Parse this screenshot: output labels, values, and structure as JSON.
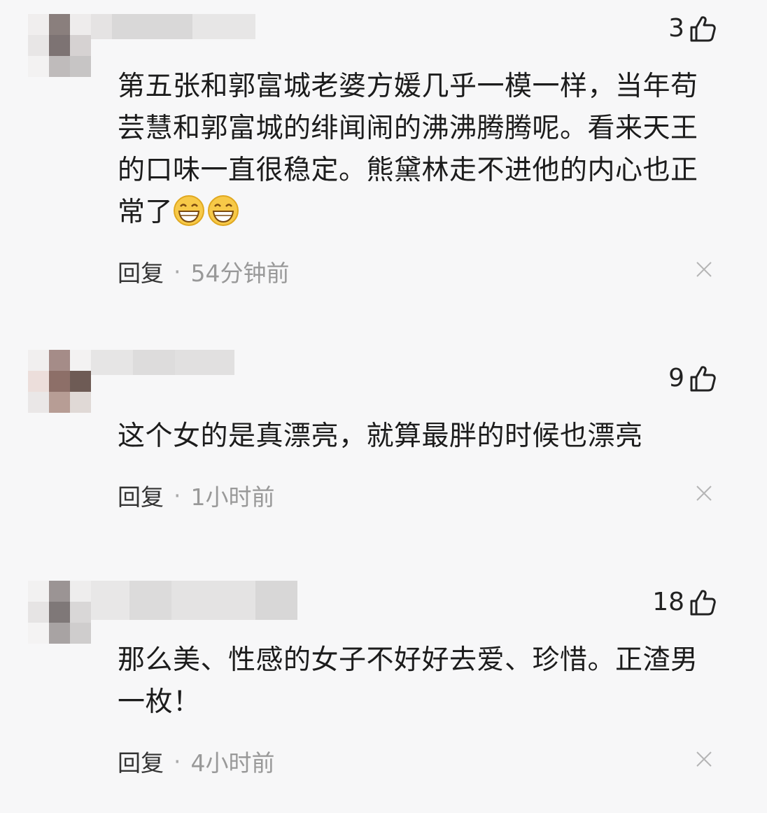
{
  "comments": [
    {
      "likes": "3",
      "text": "第五张和郭富城老婆方媛几乎一模一样，当年苟芸慧和郭富城的绯闻闹的沸沸腾腾呢。看来天王的口味一直很稳定。熊黛林走不进他的内心也正常了",
      "emojis": [
        "grin-emoji",
        "grin-emoji"
      ],
      "reply_label": "回复",
      "separator": "·",
      "time": "54分钟前"
    },
    {
      "likes": "9",
      "text": "这个女的是真漂亮，就算最胖的时候也漂亮",
      "reply_label": "回复",
      "separator": "·",
      "time": "1小时前"
    },
    {
      "likes": "18",
      "text": "那么美、性感的女子不好好去爱、珍惜。正渣男一枚！",
      "reply_label": "回复",
      "separator": "·",
      "time": "4小时前"
    }
  ],
  "icons": {
    "like": "thumbs-up-icon",
    "close": "close-icon",
    "emoji": "grin-emoji"
  },
  "colors": {
    "background": "#f7f7f8",
    "text": "#1c1c1c",
    "meta": "#999999",
    "emoji_face": "#f7c948"
  }
}
